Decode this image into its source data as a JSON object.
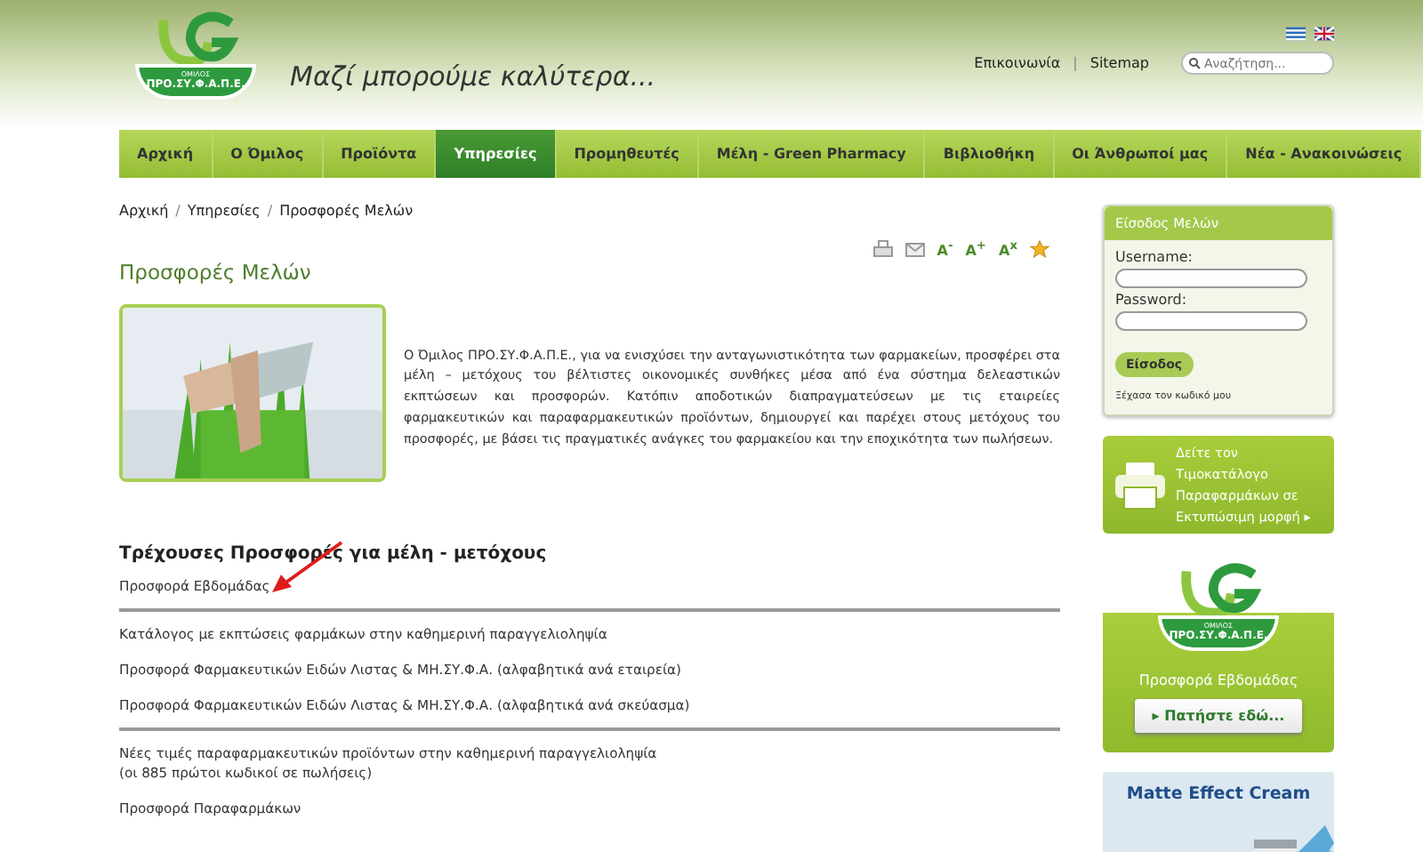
{
  "header": {
    "logo": {
      "caption": "ΟΜΙΛΟΣ",
      "name": "ΠΡΟ.ΣΥ.Φ.Α.Π.Ε."
    },
    "tagline": "Μαζί μπορούμε καλύτερα...",
    "links": [
      {
        "kind": "link",
        "text": "Επικοινωνία"
      },
      {
        "kind": "separator",
        "text": "|"
      },
      {
        "kind": "link",
        "text": "Sitemap"
      }
    ],
    "search": {
      "placeholder": "Αναζήτηση..."
    },
    "languages": [
      {
        "kind": "greek",
        "selected": false
      },
      {
        "kind": "english",
        "selected": false
      }
    ]
  },
  "nav": [
    {
      "label": "Αρχική",
      "selected": false
    },
    {
      "label": "Ο Όμιλος",
      "selected": false
    },
    {
      "label": "Προϊόντα",
      "selected": false
    },
    {
      "label": "Υπηρεσίες",
      "selected": true
    },
    {
      "label": "Προμηθευτές",
      "selected": false
    },
    {
      "label": "Μέλη - Green Pharmacy",
      "selected": false
    },
    {
      "label": "Βιβλιοθήκη",
      "selected": false
    },
    {
      "label": "Οι Άνθρωποί μας",
      "selected": false
    },
    {
      "label": "Νέα - Ανακοινώσεις",
      "selected": false
    }
  ],
  "breadcrumb": [
    {
      "kind": "link",
      "text": "Αρχική"
    },
    {
      "kind": "separator",
      "text": "/"
    },
    {
      "kind": "link",
      "text": "Υπηρεσίες"
    },
    {
      "kind": "separator",
      "text": "/"
    },
    {
      "kind": "link",
      "text": "Προσφορές Μελών"
    }
  ],
  "tools": [
    {
      "kind": "print"
    },
    {
      "kind": "email"
    },
    {
      "kind": "text",
      "label": "A$^{-}$"
    },
    {
      "kind": "text",
      "label": "A$^{+}$"
    },
    {
      "kind": "text",
      "label": "A$^{x}$"
    },
    {
      "kind": "star"
    }
  ],
  "page_title": "Προσφορές Μελών",
  "intro": "Ο Όμιλος ΠΡΟ.ΣΥ.Φ.Α.Π.Ε., για να ενισχύσει την ανταγωνιστικότητα των φαρμακείων, προσφέρει στα μέλη – μετόχους του βέλτιστες οικονομικές συνθήκες μέσα από ένα σύστημα δελεαστικών εκπτώσεων και προσφορών. Κατόπιν αποδοτικών διαπραγματεύσεων με τις εταιρείες φαρμακευτικών και παραφαρμακευτικών προϊόντων, δημιουργεί και παρέχει στους μετόχους του προσφορές, με βάσει τις πραγματικές ανάγκες του φαρμακείου και την εποχικότητα των πωλήσεων.",
  "offers": {
    "heading": "Τρέχουσες Προσφορές για μέλη - μετόχους",
    "groups": [
      [
        "Προσφορά Εβδομάδας"
      ],
      [
        "Κατάλογος με εκπτώσεις φαρμάκων στην καθημερινή παραγγελιοληψία",
        "Προσφορά Φαρμακευτικών Ειδών Λιστας & ΜΗ.ΣΥ.Φ.Α. (αλφαβητικά ανά εταιρεία)",
        "Προσφορά Φαρμακευτικών Ειδών Λιστας & ΜΗ.ΣΥ.Φ.Α. (αλφαβητικά ανά σκεύασμα)"
      ],
      [
        "Νέες τιμές παραφαρμακευτικών προϊόντων στην καθημερινή παραγγελιοληψία\n(οι 885 πρώτοι κωδικοί σε πωλήσεις)",
        "Προσφορά Παραφαρμάκων"
      ]
    ]
  },
  "login": {
    "title": "Είσοδος Μελών",
    "fields": [
      "Username:",
      "Password:"
    ],
    "button": "Είσοδος",
    "forgot": "Ξέχασα τον κωδικό μου"
  },
  "pricelist_banner": "Δείτε τον Τιμοκατάλογο Παραφαρμάκων σε Εκτυπώσιμη μορφή ▸",
  "weekly_banner": {
    "logo": {
      "caption": "ΟΜΙΛΟΣ",
      "name": "ΠΡΟ.ΣΥ.Φ.Α.Π.Ε."
    },
    "title": "Προσφορά Εβδομάδας",
    "button": "▸ Πατήστε εδώ..."
  },
  "ad": {
    "title": "Matte Effect Cream"
  }
}
